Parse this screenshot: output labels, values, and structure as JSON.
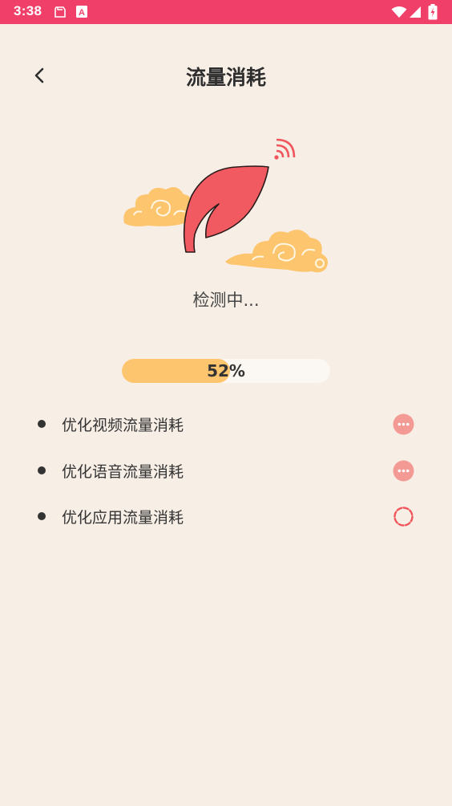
{
  "status_bar": {
    "time": "3:38",
    "left_icons": [
      "clipboard-icon",
      "font-a-icon"
    ],
    "right_icons": [
      "wifi-icon",
      "signal-icon",
      "battery-charging-icon"
    ]
  },
  "header": {
    "back_icon": "chevron-left-icon",
    "title": "流量消耗"
  },
  "hero": {
    "icons": [
      "leaf-icon",
      "wifi-signal-icon",
      "cloud-left-icon",
      "cloud-right-icon"
    ],
    "status_text": "检测中..."
  },
  "progress": {
    "value_percent": 52,
    "label": "52%"
  },
  "tasks": [
    {
      "label": "优化视频流量消耗",
      "state": "pending",
      "icon": "more-dots-icon"
    },
    {
      "label": "优化语音流量消耗",
      "state": "pending",
      "icon": "more-dots-icon"
    },
    {
      "label": "优化应用流量消耗",
      "state": "loading",
      "icon": "loading-spinner-icon"
    }
  ],
  "colors": {
    "status_bar": "#f0406a",
    "background": "#f7eee6",
    "leaf": "#f05a60",
    "cloud": "#fdc56e",
    "progress_fill": "#fdc56e",
    "progress_track": "#fbf7f2",
    "pending_dot": "#f49a94",
    "spinner": "#f0565c"
  }
}
